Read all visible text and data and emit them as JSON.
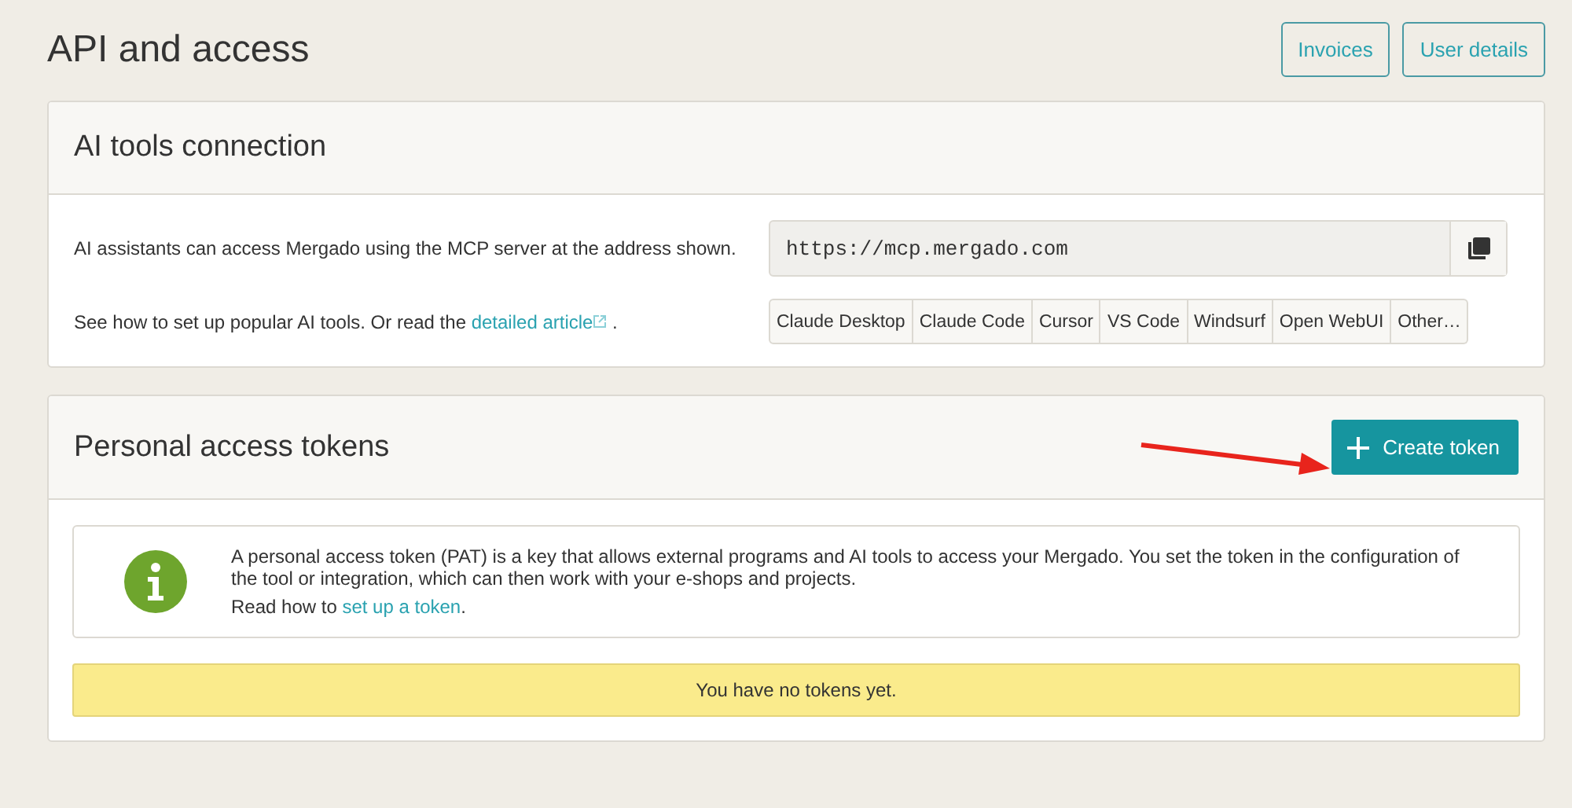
{
  "page": {
    "title": "API and access",
    "buttons": [
      "Invoices",
      "User details"
    ]
  },
  "ai_tools": {
    "title": "AI tools connection",
    "description": "AI assistants can access Mergado using the MCP server at the address shown.",
    "server_url": "https://mcp.mergado.com",
    "setup": {
      "before": "See how to set up popular AI tools. Or read the ",
      "link": "detailed article",
      "after": " ."
    },
    "tools": [
      "Claude Desktop",
      "Claude Code",
      "Cursor",
      "VS Code",
      "Windsurf",
      "Open WebUI",
      "Other…"
    ]
  },
  "tokens": {
    "title": "Personal access tokens",
    "create_button": "Create token",
    "info": {
      "text": "A personal access token (PAT) is a key that allows external programs and AI tools to access your Mergado. You set the token in the configuration of the tool or integration, which can then work with your e-shops and projects.",
      "read_before": "Read how to ",
      "read_link": "set up a token",
      "read_after": "."
    },
    "empty_message": "You have no tokens yet."
  }
}
